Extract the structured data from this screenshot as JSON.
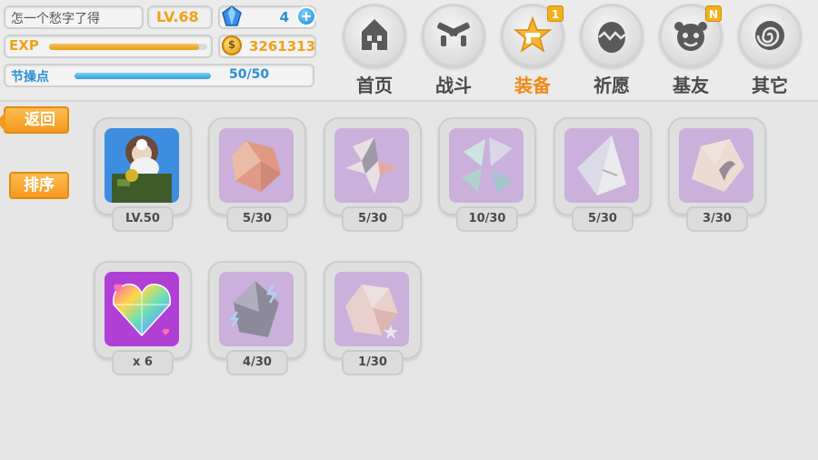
{
  "player": {
    "name": "怎一个愁字了得",
    "level": "LV.68",
    "exp_label": "EXP",
    "exp_fraction": 0.95,
    "stamina_label": "节操点",
    "stamina_value": "50/50",
    "stamina_fraction": 1.0,
    "gems": "4",
    "coins": "3261313"
  },
  "nav": [
    {
      "label": "首页",
      "icon": "house-icon"
    },
    {
      "label": "战斗",
      "icon": "crossed-guns-icon"
    },
    {
      "label": "装备",
      "icon": "star-gun-icon",
      "badge": "1",
      "active": true
    },
    {
      "label": "祈愿",
      "icon": "egg-icon"
    },
    {
      "label": "基友",
      "icon": "friend-face-icon",
      "badge": "N"
    },
    {
      "label": "其它",
      "icon": "spiral-icon"
    }
  ],
  "buttons": {
    "back": "返回",
    "sort": "排序"
  },
  "items": [
    {
      "count": "LV.50",
      "type": "character"
    },
    {
      "count": "5/30",
      "type": "red-crystal"
    },
    {
      "count": "5/30",
      "type": "shard-crystal"
    },
    {
      "count": "10/30",
      "type": "green-crystal"
    },
    {
      "count": "5/30",
      "type": "white-crystal"
    },
    {
      "count": "3/30",
      "type": "peach-crystal"
    },
    {
      "count": "x 6",
      "type": "rainbow-heart"
    },
    {
      "count": "4/30",
      "type": "dark-crystal"
    },
    {
      "count": "1/30",
      "type": "rose-crystal"
    }
  ],
  "colors": {
    "accent": "#f08a1a",
    "blue": "#2a8fd6",
    "slot_purple": "#b98ad6"
  }
}
